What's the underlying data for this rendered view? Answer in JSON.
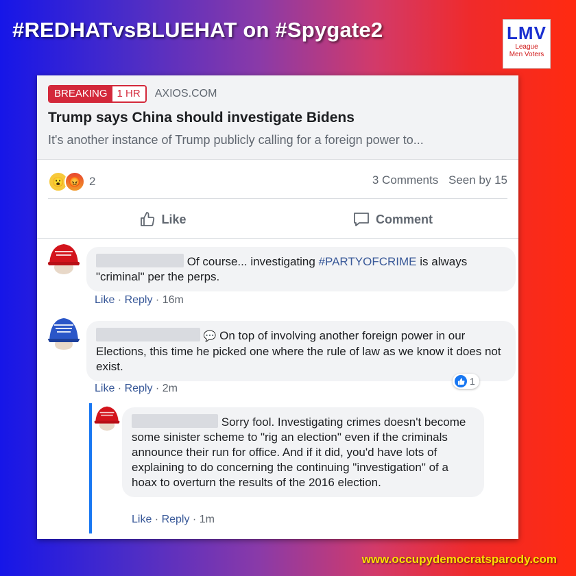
{
  "header": {
    "headline": "#REDHATvsBLUEHAT on #Spygate2",
    "logo_main": "LMV",
    "logo_line1": "League",
    "logo_line2": "Men Voters"
  },
  "footer": {
    "url": "www.occupydemocratsparody.com"
  },
  "post": {
    "badge_label": "BREAKING",
    "badge_time": "1 HR",
    "source": "AXIOS.COM",
    "title": "Trump says China should investigate Bidens",
    "description": "It's another instance of Trump publicly calling for a foreign power to...",
    "reaction_icons": [
      "wow-emoji-icon",
      "angry-emoji-icon"
    ],
    "reaction_count": "2",
    "comments_count": "3 Comments",
    "seen_by": "Seen by 15",
    "like_label": "Like",
    "comment_label": "Comment"
  },
  "comments": [
    {
      "avatar": "red-maga-hat-avatar",
      "text_before": "Of course... investigating ",
      "hashtag": "#PARTYOFCRIME",
      "text_after": " is always \"criminal\" per the perps.",
      "like": "Like",
      "reply": "Reply",
      "time": "16m"
    },
    {
      "avatar": "blue-hat-avatar",
      "text": "On top of involving another foreign power in our Elections, this time he picked one where the rule of law as we know it does not exist.",
      "reaction_count": "1",
      "like": "Like",
      "reply": "Reply",
      "time": "2m"
    },
    {
      "avatar": "red-maga-hat-avatar",
      "text": "Sorry fool. Investigating crimes doesn't become some sinister scheme to \"rig an election\" even if the criminals announce their run for office. And if it did, you'd have lots of explaining to do concerning the continuing \"investigation\" of a hoax to overturn the results of the 2016 election.",
      "like": "Like",
      "reply": "Reply",
      "time": "1m"
    }
  ],
  "colors": {
    "link_blue": "#385898",
    "breaking_red": "#d3283a",
    "footer_yellow": "#ffe000",
    "reply_bar": "#1877f2"
  }
}
